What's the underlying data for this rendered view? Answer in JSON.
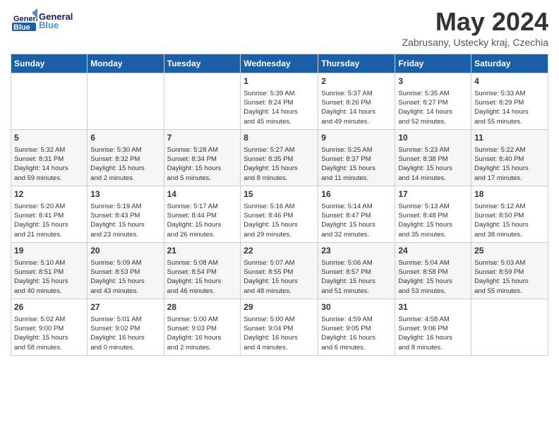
{
  "header": {
    "logo_general": "General",
    "logo_blue": "Blue",
    "month_title": "May 2024",
    "subtitle": "Zabrusany, Ustecky kraj, Czechia"
  },
  "days_of_week": [
    "Sunday",
    "Monday",
    "Tuesday",
    "Wednesday",
    "Thursday",
    "Friday",
    "Saturday"
  ],
  "weeks": [
    [
      {
        "day": "",
        "data": ""
      },
      {
        "day": "",
        "data": ""
      },
      {
        "day": "",
        "data": ""
      },
      {
        "day": "1",
        "data": "Sunrise: 5:39 AM\nSunset: 8:24 PM\nDaylight: 14 hours\nand 45 minutes."
      },
      {
        "day": "2",
        "data": "Sunrise: 5:37 AM\nSunset: 8:26 PM\nDaylight: 14 hours\nand 49 minutes."
      },
      {
        "day": "3",
        "data": "Sunrise: 5:35 AM\nSunset: 8:27 PM\nDaylight: 14 hours\nand 52 minutes."
      },
      {
        "day": "4",
        "data": "Sunrise: 5:33 AM\nSunset: 8:29 PM\nDaylight: 14 hours\nand 55 minutes."
      }
    ],
    [
      {
        "day": "5",
        "data": "Sunrise: 5:32 AM\nSunset: 8:31 PM\nDaylight: 14 hours\nand 59 minutes."
      },
      {
        "day": "6",
        "data": "Sunrise: 5:30 AM\nSunset: 8:32 PM\nDaylight: 15 hours\nand 2 minutes."
      },
      {
        "day": "7",
        "data": "Sunrise: 5:28 AM\nSunset: 8:34 PM\nDaylight: 15 hours\nand 5 minutes."
      },
      {
        "day": "8",
        "data": "Sunrise: 5:27 AM\nSunset: 8:35 PM\nDaylight: 15 hours\nand 8 minutes."
      },
      {
        "day": "9",
        "data": "Sunrise: 5:25 AM\nSunset: 8:37 PM\nDaylight: 15 hours\nand 11 minutes."
      },
      {
        "day": "10",
        "data": "Sunrise: 5:23 AM\nSunset: 8:38 PM\nDaylight: 15 hours\nand 14 minutes."
      },
      {
        "day": "11",
        "data": "Sunrise: 5:22 AM\nSunset: 8:40 PM\nDaylight: 15 hours\nand 17 minutes."
      }
    ],
    [
      {
        "day": "12",
        "data": "Sunrise: 5:20 AM\nSunset: 8:41 PM\nDaylight: 15 hours\nand 21 minutes."
      },
      {
        "day": "13",
        "data": "Sunrise: 5:19 AM\nSunset: 8:43 PM\nDaylight: 15 hours\nand 23 minutes."
      },
      {
        "day": "14",
        "data": "Sunrise: 5:17 AM\nSunset: 8:44 PM\nDaylight: 15 hours\nand 26 minutes."
      },
      {
        "day": "15",
        "data": "Sunrise: 5:16 AM\nSunset: 8:46 PM\nDaylight: 15 hours\nand 29 minutes."
      },
      {
        "day": "16",
        "data": "Sunrise: 5:14 AM\nSunset: 8:47 PM\nDaylight: 15 hours\nand 32 minutes."
      },
      {
        "day": "17",
        "data": "Sunrise: 5:13 AM\nSunset: 8:48 PM\nDaylight: 15 hours\nand 35 minutes."
      },
      {
        "day": "18",
        "data": "Sunrise: 5:12 AM\nSunset: 8:50 PM\nDaylight: 15 hours\nand 38 minutes."
      }
    ],
    [
      {
        "day": "19",
        "data": "Sunrise: 5:10 AM\nSunset: 8:51 PM\nDaylight: 15 hours\nand 40 minutes."
      },
      {
        "day": "20",
        "data": "Sunrise: 5:09 AM\nSunset: 8:53 PM\nDaylight: 15 hours\nand 43 minutes."
      },
      {
        "day": "21",
        "data": "Sunrise: 5:08 AM\nSunset: 8:54 PM\nDaylight: 15 hours\nand 46 minutes."
      },
      {
        "day": "22",
        "data": "Sunrise: 5:07 AM\nSunset: 8:55 PM\nDaylight: 15 hours\nand 48 minutes."
      },
      {
        "day": "23",
        "data": "Sunrise: 5:06 AM\nSunset: 8:57 PM\nDaylight: 15 hours\nand 51 minutes."
      },
      {
        "day": "24",
        "data": "Sunrise: 5:04 AM\nSunset: 8:58 PM\nDaylight: 15 hours\nand 53 minutes."
      },
      {
        "day": "25",
        "data": "Sunrise: 5:03 AM\nSunset: 8:59 PM\nDaylight: 15 hours\nand 55 minutes."
      }
    ],
    [
      {
        "day": "26",
        "data": "Sunrise: 5:02 AM\nSunset: 9:00 PM\nDaylight: 15 hours\nand 58 minutes."
      },
      {
        "day": "27",
        "data": "Sunrise: 5:01 AM\nSunset: 9:02 PM\nDaylight: 16 hours\nand 0 minutes."
      },
      {
        "day": "28",
        "data": "Sunrise: 5:00 AM\nSunset: 9:03 PM\nDaylight: 16 hours\nand 2 minutes."
      },
      {
        "day": "29",
        "data": "Sunrise: 5:00 AM\nSunset: 9:04 PM\nDaylight: 16 hours\nand 4 minutes."
      },
      {
        "day": "30",
        "data": "Sunrise: 4:59 AM\nSunset: 9:05 PM\nDaylight: 16 hours\nand 6 minutes."
      },
      {
        "day": "31",
        "data": "Sunrise: 4:58 AM\nSunset: 9:06 PM\nDaylight: 16 hours\nand 8 minutes."
      },
      {
        "day": "",
        "data": ""
      }
    ]
  ]
}
